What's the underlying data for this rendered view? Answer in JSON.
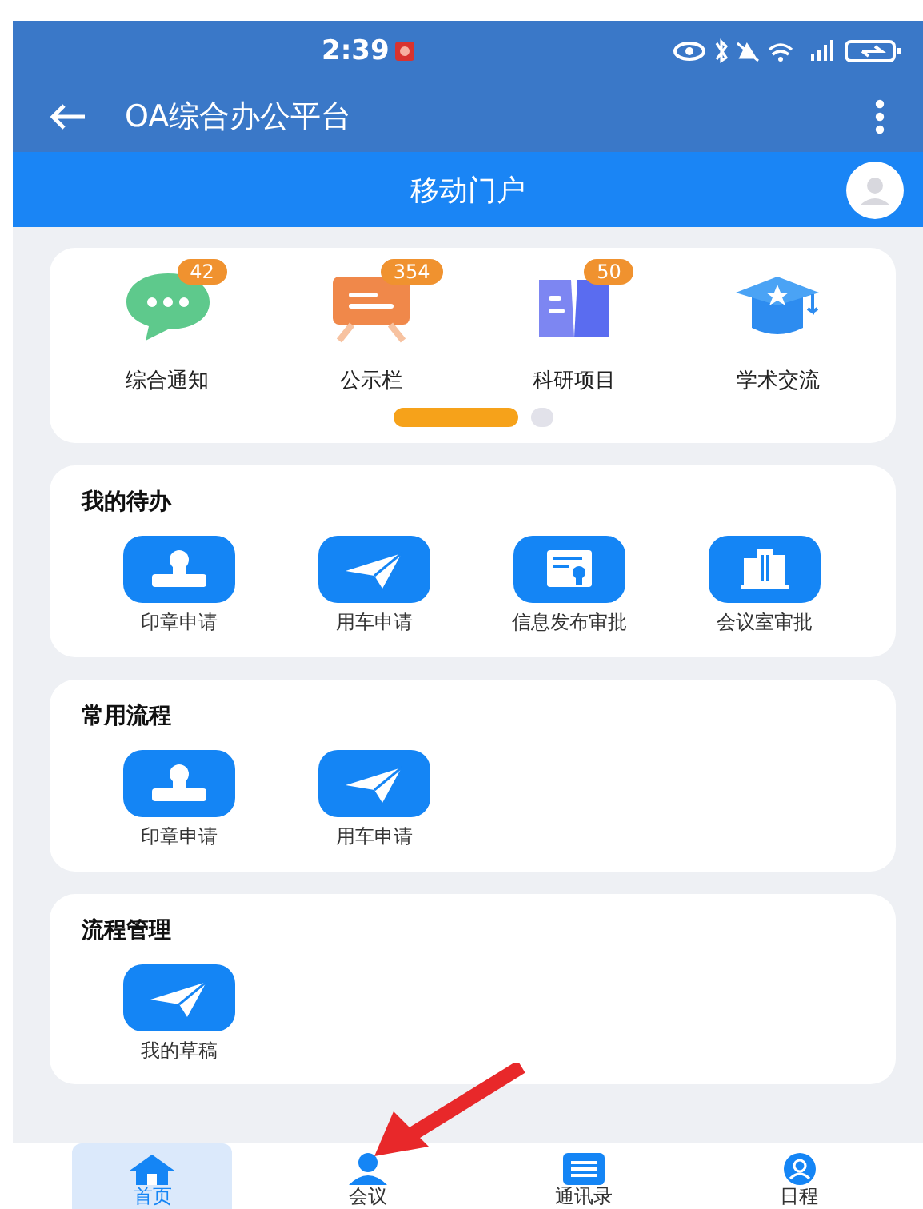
{
  "status_bar": {
    "time": "2:39"
  },
  "app_bar": {
    "title": "OA综合办公平台"
  },
  "header": {
    "title": "移动门户"
  },
  "carousel": {
    "items": [
      {
        "label": "综合通知",
        "badge": "42",
        "kind": "chat"
      },
      {
        "label": "公示栏",
        "badge": "354",
        "kind": "board"
      },
      {
        "label": "科研项目",
        "badge": "50",
        "kind": "book"
      },
      {
        "label": "学术交流",
        "kind": "cap"
      }
    ],
    "pages": [
      {
        "selected": true
      },
      {
        "selected": false
      }
    ]
  },
  "sections": [
    {
      "title": "我的待办",
      "items": [
        {
          "label": "印章申请",
          "kind": "stamp"
        },
        {
          "label": "用车申请",
          "kind": "plane"
        },
        {
          "label": "信息发布审批",
          "kind": "certificate"
        },
        {
          "label": "会议室审批",
          "kind": "building"
        }
      ]
    },
    {
      "title": "常用流程",
      "items": [
        {
          "label": "印章申请",
          "kind": "stamp"
        },
        {
          "label": "用车申请",
          "kind": "plane"
        }
      ]
    },
    {
      "title": "流程管理",
      "items": [
        {
          "label": "我的草稿",
          "kind": "plane"
        }
      ]
    }
  ],
  "bottom_nav": [
    {
      "label": "首页",
      "kind": "home",
      "selected": true
    },
    {
      "label": "会议",
      "kind": "person",
      "selected": false
    },
    {
      "label": "通讯录",
      "kind": "list",
      "selected": false
    },
    {
      "label": "日程",
      "kind": "avatar",
      "selected": false
    }
  ]
}
